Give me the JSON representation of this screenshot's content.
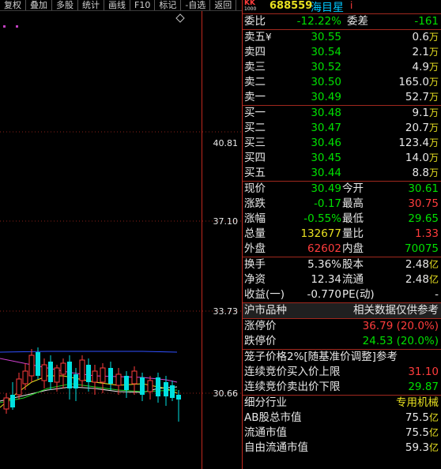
{
  "toolbar": {
    "items": [
      "复权",
      "叠加",
      "多股",
      "统计",
      "画线",
      "F10",
      "标记",
      "-自选",
      "返回"
    ]
  },
  "chart": {
    "price_labels": [
      "40.81",
      "37.10",
      "33.73",
      "30.66"
    ]
  },
  "stock": {
    "code": "688559",
    "name": "海目星",
    "badge_top": "KK",
    "badge_bottom": "1000",
    "suffix": "i"
  },
  "weibi": {
    "label": "委比",
    "value": "-12.22%",
    "label2": "委差",
    "value2": "-161"
  },
  "sell": [
    {
      "label": "卖五",
      "price": "30.55",
      "vol": "0.6",
      "unit": "万",
      "mark": "¥"
    },
    {
      "label": "卖四",
      "price": "30.54",
      "vol": "2.1",
      "unit": "万"
    },
    {
      "label": "卖三",
      "price": "30.52",
      "vol": "4.9",
      "unit": "万"
    },
    {
      "label": "卖二",
      "price": "30.50",
      "vol": "165.0",
      "unit": "万"
    },
    {
      "label": "卖一",
      "price": "30.49",
      "vol": "52.7",
      "unit": "万"
    }
  ],
  "buy": [
    {
      "label": "买一",
      "price": "30.48",
      "vol": "9.1",
      "unit": "万"
    },
    {
      "label": "买二",
      "price": "30.47",
      "vol": "20.7",
      "unit": "万"
    },
    {
      "label": "买三",
      "price": "30.46",
      "vol": "123.4",
      "unit": "万"
    },
    {
      "label": "买四",
      "price": "30.45",
      "vol": "14.0",
      "unit": "万"
    },
    {
      "label": "买五",
      "price": "30.44",
      "vol": "8.8",
      "unit": "万"
    }
  ],
  "quote": {
    "xianjia": {
      "label": "现价",
      "value": "30.49",
      "label2": "今开",
      "value2": "30.61"
    },
    "zhangdie": {
      "label": "涨跌",
      "value": "-0.17",
      "label2": "最高",
      "value2": "30.75"
    },
    "zhangfu": {
      "label": "涨幅",
      "value": "-0.55%",
      "label2": "最低",
      "value2": "29.65"
    },
    "zongliang": {
      "label": "总量",
      "value": "132677",
      "label2": "量比",
      "value2": "1.33"
    },
    "waipan": {
      "label": "外盘",
      "value": "62602",
      "label2": "内盘",
      "value2": "70075"
    }
  },
  "fin": {
    "huanshou": {
      "label": "换手",
      "value": "5.36%",
      "label2": "股本",
      "value2": "2.48",
      "unit": "亿"
    },
    "jingzi": {
      "label": "净资",
      "value": "12.34",
      "label2": "流通",
      "value2": "2.48",
      "unit": "亿"
    },
    "shouyi": {
      "label": "收益(一)",
      "value": "-0.770",
      "label2": "PE(动)",
      "value2": "-"
    }
  },
  "market": {
    "label": "沪市品种",
    "note": "相关数据仅供参考"
  },
  "limits": {
    "up": {
      "label": "涨停价",
      "value": "36.79 (20.0%)"
    },
    "down": {
      "label": "跌停价",
      "value": "24.53 (20.0%)"
    }
  },
  "cage": {
    "title": "笼子价格2%[随基准价调整]参考",
    "buy": {
      "label": "连续竞价买入价上限",
      "value": "31.10"
    },
    "sell": {
      "label": "连续竞价卖出价下限",
      "value": "29.87"
    }
  },
  "industry": {
    "label": "细分行业",
    "value": "专用机械"
  },
  "cap": [
    {
      "label": "AB股总市值",
      "value": "75.5",
      "unit": "亿"
    },
    {
      "label": "流通市值",
      "value": "75.5",
      "unit": "亿"
    },
    {
      "label": "自由流通市值",
      "value": "59.3",
      "unit": "亿"
    }
  ]
}
